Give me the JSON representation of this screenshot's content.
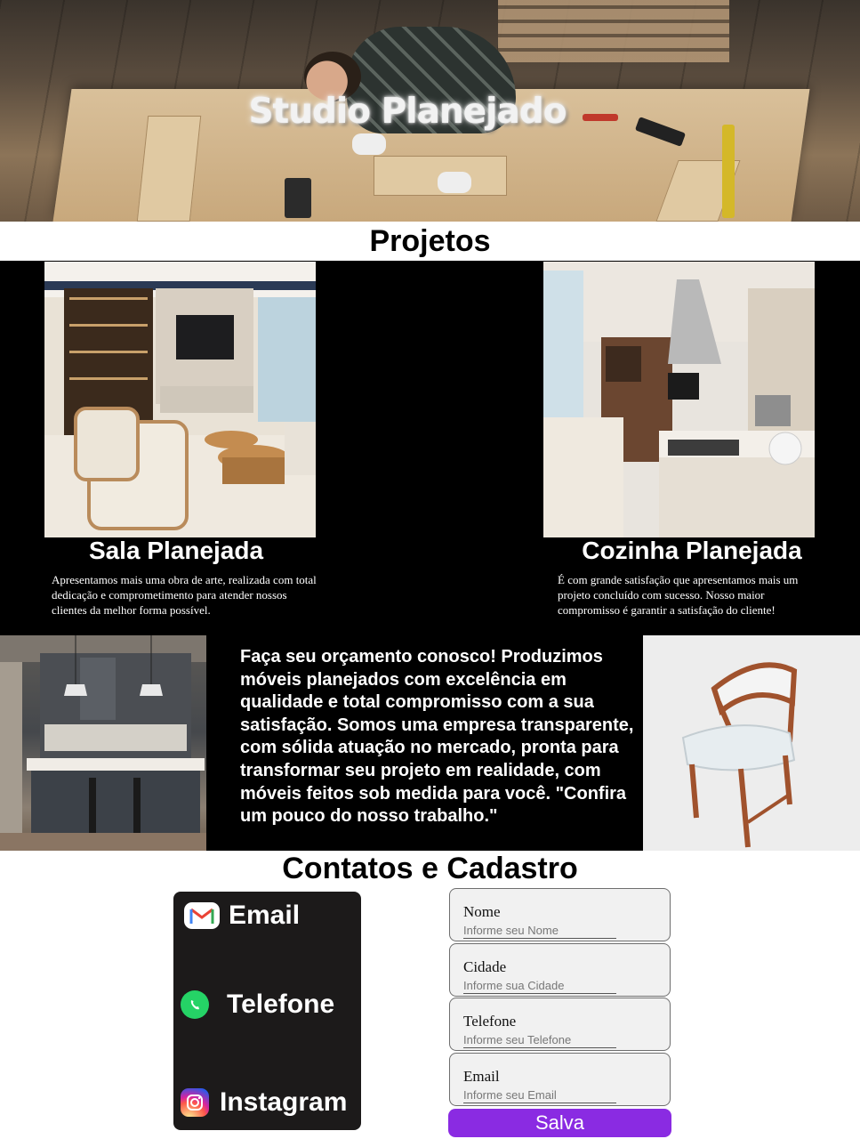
{
  "hero": {
    "title": "Studio Planejado"
  },
  "projects": {
    "title": "Projetos",
    "items": [
      {
        "title": "Sala Planejada",
        "text": "Apresentamos mais uma obra de arte, realizada com total dedicação e comprometimento para atender nossos clientes da melhor forma possível."
      },
      {
        "title": "Cozinha Planejada",
        "text": "É com grande satisfação que apresentamos mais um projeto concluído com sucesso. Nosso maior compromisso é garantir a satisfação do cliente!"
      }
    ]
  },
  "about": {
    "text": "Faça seu orçamento conosco! Produzimos móveis planejados com excelência em qualidade e total compromisso com a sua satisfação. Somos uma empresa transparente, com sólida atuação no mercado, pronta para transformar seu projeto em realidade, com móveis feitos sob medida para você. \"Confira um pouco do nosso trabalho.\""
  },
  "contacts": {
    "title": "Contatos e Cadastro",
    "items": [
      {
        "label": "Email",
        "icon": "gmail-icon"
      },
      {
        "label": "Telefone",
        "icon": "whatsapp-icon"
      },
      {
        "label": "Instagram",
        "icon": "instagram-icon"
      }
    ]
  },
  "form": {
    "fields": [
      {
        "label": "Nome",
        "placeholder": "Informe seu Nome"
      },
      {
        "label": "Cidade",
        "placeholder": "Informe sua Cidade"
      },
      {
        "label": "Telefone",
        "placeholder": "Informe seu Telefone"
      },
      {
        "label": "Email",
        "placeholder": "Informe seu Email"
      }
    ],
    "submit_label": "Salva"
  },
  "colors": {
    "button": "#8a2be2",
    "dark_section": "#000000",
    "contact_box": "#1c1a1a",
    "whatsapp": "#25d366"
  }
}
